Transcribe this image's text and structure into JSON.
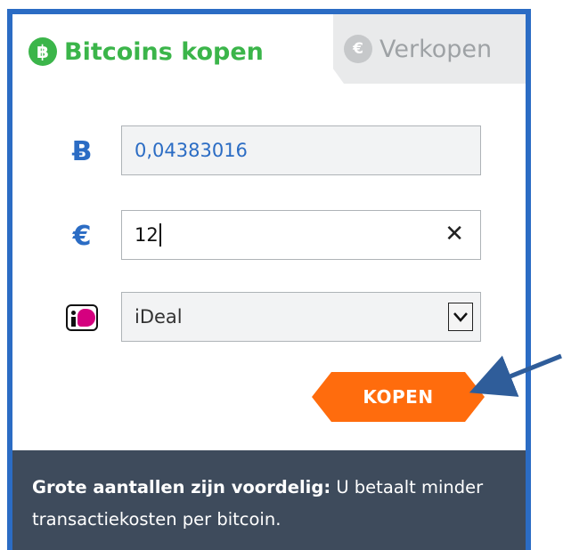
{
  "tabs": {
    "buy": {
      "icon": "bitcoin-coin-icon",
      "label": "Bitcoins kopen"
    },
    "sell": {
      "icon": "euro-coin-icon",
      "label": "Verkopen"
    }
  },
  "form": {
    "btc": {
      "icon": "bitcoin-icon",
      "symbol": "Ƀ",
      "value": "0,04383016"
    },
    "eur": {
      "icon": "euro-icon",
      "symbol": "€",
      "value": "12"
    },
    "payment": {
      "icon": "ideal-logo-icon",
      "selected": "iDeal"
    }
  },
  "actions": {
    "buy_label": "KOPEN"
  },
  "footer": {
    "bold": "Grote aantallen zijn voordelig:",
    "text": " U betaalt minder transactiekosten per bitcoin."
  },
  "colors": {
    "accent_blue": "#2b6cc4",
    "green": "#3bb54a",
    "orange": "#ff6c0d",
    "footer_bg": "#3e4b5c"
  }
}
